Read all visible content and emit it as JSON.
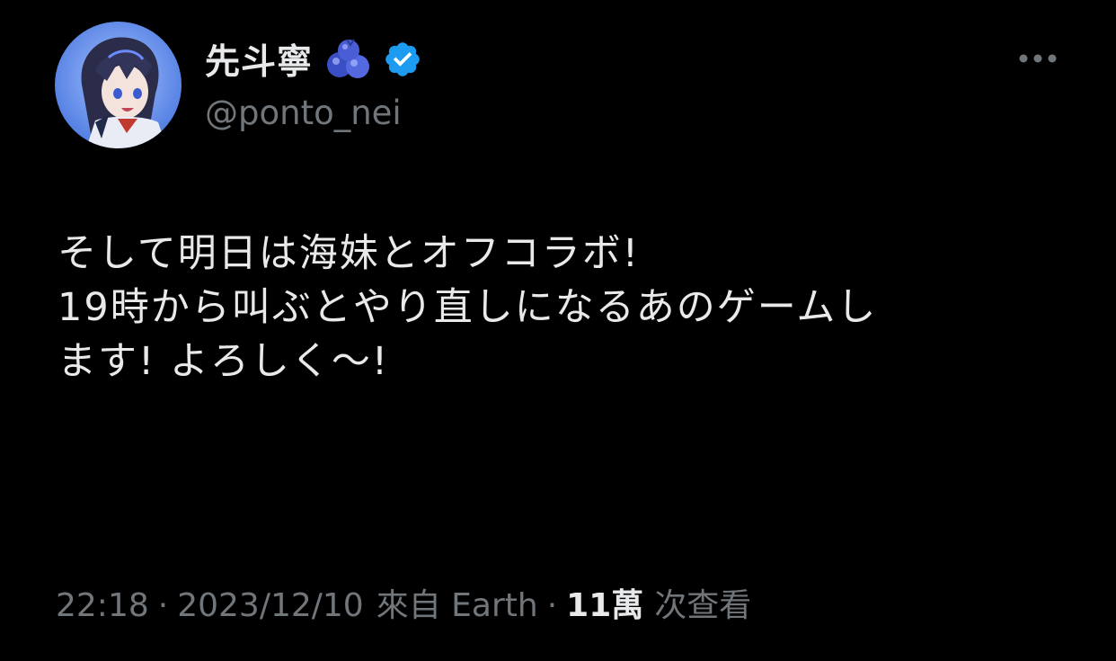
{
  "author": {
    "display_name": "先斗寧",
    "name_emoji": "blueberries-icon",
    "verified_icon": "verified-badge-icon",
    "handle": "@ponto_nei",
    "avatar": "avatar"
  },
  "header": {
    "more_icon": "more-horizontal-icon"
  },
  "tweet": {
    "lines": [
      "そして明日は海妹とオフコラボ!",
      "19時から叫ぶとやり直しになるあのゲームし",
      "ます! よろしく〜!"
    ]
  },
  "meta": {
    "time": "22:18",
    "separator": "·",
    "date": "2023/12/10",
    "source": "來自 Earth",
    "views_count": "11萬",
    "views_label": "次查看"
  },
  "colors": {
    "background": "#000000",
    "primary_text": "#e7e9ea",
    "secondary_text": "#71767b",
    "verified_blue": "#1d9bf0"
  }
}
